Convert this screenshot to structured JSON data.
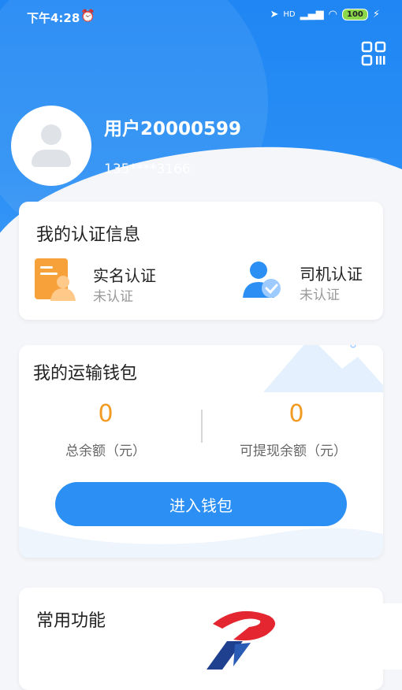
{
  "status_bar": {
    "time": "下午4:28",
    "battery": "100",
    "signal": "HD"
  },
  "profile": {
    "username": "用户20000599",
    "phone": "135****3166"
  },
  "auth_card": {
    "title": "我的认证信息",
    "items": [
      {
        "label": "实名认证",
        "status": "未认证",
        "icon": "id-card-icon"
      },
      {
        "label": "司机认证",
        "status": "未认证",
        "icon": "driver-verified-icon"
      }
    ]
  },
  "wallet_card": {
    "title": "我的运输钱包",
    "total_balance": "0",
    "total_balance_label": "总余额（元）",
    "withdrawable_balance": "0",
    "withdrawable_label": "可提现余额（元）",
    "enter_button": "进入钱包"
  },
  "functions_card": {
    "title": "常用功能"
  },
  "colors": {
    "primary": "#2b8ff3",
    "amount": "#f29a22",
    "auth_icon_orange": "#f7a13a"
  }
}
